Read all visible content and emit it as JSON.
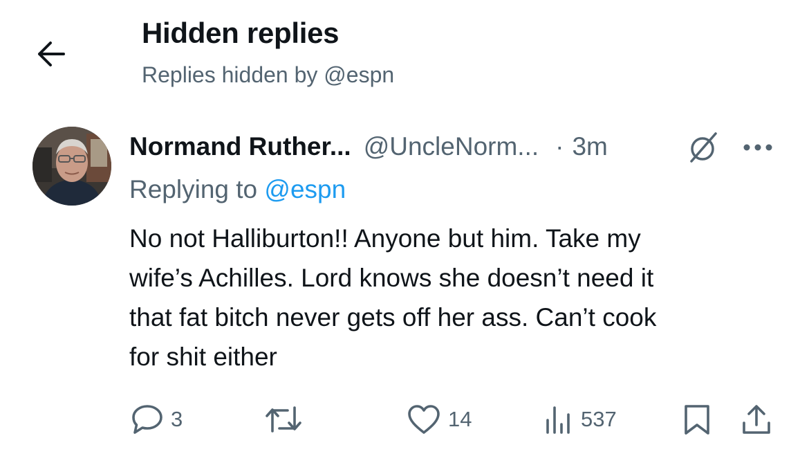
{
  "header": {
    "title": "Hidden replies",
    "subtitle": "Replies hidden by @espn",
    "back_icon": "arrow-left-icon"
  },
  "tweet": {
    "author_name": "Normand Ruther...",
    "author_handle": "@UncleNorm...",
    "separator": "·",
    "time": "3m",
    "hidden_icon": "hidden-reply-icon",
    "more_icon": "more-horizontal-icon",
    "replying_prefix": "Replying to",
    "replying_to": "@espn",
    "text_lines": [
      "No not Halliburton!! Anyone but him. Take my",
      "wife’s Achilles. Lord knows she doesn’t need it",
      "that fat bitch never gets off her ass. Can’t cook",
      "for shit either"
    ]
  },
  "actions": {
    "reply": {
      "icon": "reply-icon",
      "count": "3"
    },
    "retweet": {
      "icon": "retweet-icon",
      "count": ""
    },
    "like": {
      "icon": "heart-icon",
      "count": "14"
    },
    "views": {
      "icon": "views-icon",
      "count": "537"
    },
    "bookmark": {
      "icon": "bookmark-icon"
    },
    "share": {
      "icon": "share-icon"
    }
  },
  "colors": {
    "text_primary": "#0f1419",
    "text_secondary": "#536471",
    "link": "#1d9bf0",
    "background": "#ffffff"
  }
}
